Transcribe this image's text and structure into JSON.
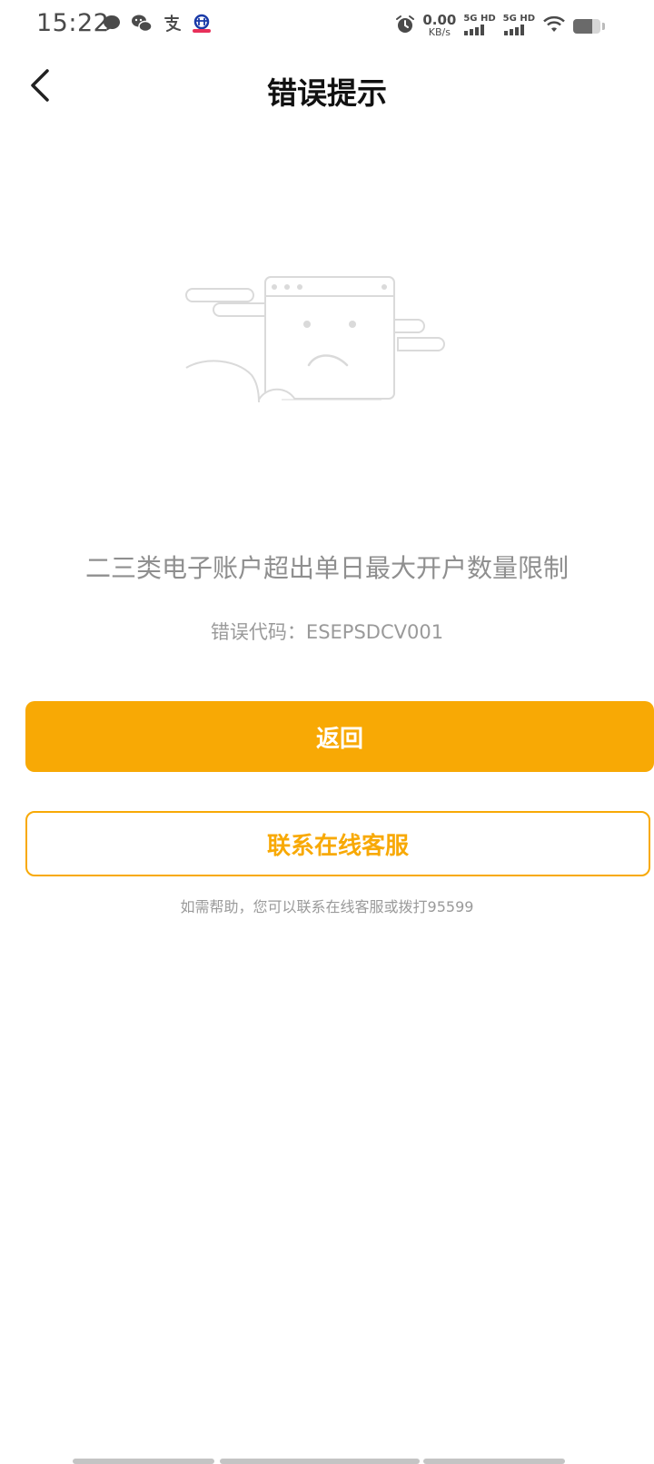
{
  "status_bar": {
    "time": "15:22",
    "net_speed_value": "0.00",
    "net_speed_unit": "KB/s",
    "sim1": "5G HD",
    "sim2": "5G HD",
    "battery_level": 0.7,
    "left_icons": [
      "message-icon",
      "wechat-icon",
      "alipay-icon",
      "bank-app-icon"
    ],
    "right_icons": [
      "alarm-icon",
      "signal-icon",
      "wifi-icon",
      "battery-icon"
    ]
  },
  "header": {
    "title": "错误提示",
    "back_icon": "chevron-left-icon"
  },
  "illustration": {
    "icon": "sad-browser-illustration"
  },
  "error": {
    "message": "二三类电子账户超出单日最大开户数量限制",
    "code_text": "错误代码：ESEPSDCV001"
  },
  "buttons": {
    "return_label": "返回",
    "service_label": "联系在线客服"
  },
  "help_text": "如需帮助，您可以联系在线客服或拨打95599",
  "colors": {
    "accent": "#f8a905",
    "muted_text": "#8f8f8f",
    "title": "#111111"
  }
}
